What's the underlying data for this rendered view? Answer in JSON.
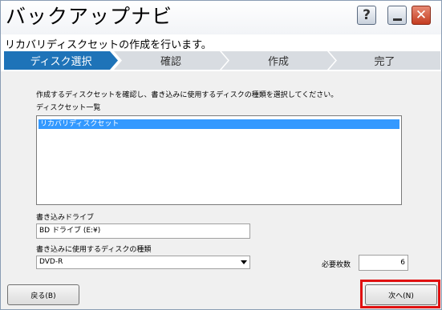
{
  "window": {
    "title": "バックアップナビ",
    "help_glyph": "?",
    "close_glyph": "✕"
  },
  "subtitle": "リカバリディスクセットの作成を行います。",
  "steps": [
    {
      "label": "ディスク選択",
      "active": true
    },
    {
      "label": "確認",
      "active": false
    },
    {
      "label": "作成",
      "active": false
    },
    {
      "label": "完了",
      "active": false
    }
  ],
  "main": {
    "instruction": "作成するディスクセットを確認し、書き込みに使用するディスクの種類を選択してください。",
    "disc_set_label": "ディスクセット一覧",
    "disc_set_items": [
      "リカバリディスクセット"
    ],
    "drive_label": "書き込みドライブ",
    "drive_value": "BD ドライブ (E:¥)",
    "disc_type_label": "書き込みに使用するディスクの種類",
    "disc_type_value": "DVD-R",
    "required_count_label": "必要枚数",
    "required_count_value": "6"
  },
  "buttons": {
    "back_label": "戻る(B)",
    "next_label": "次へ(N)"
  },
  "colors": {
    "active_step": "#1e73b8",
    "inactive_step": "#d8dce1",
    "selection": "#3399ff",
    "highlight": "#e01010",
    "close_button": "#c43c20"
  }
}
